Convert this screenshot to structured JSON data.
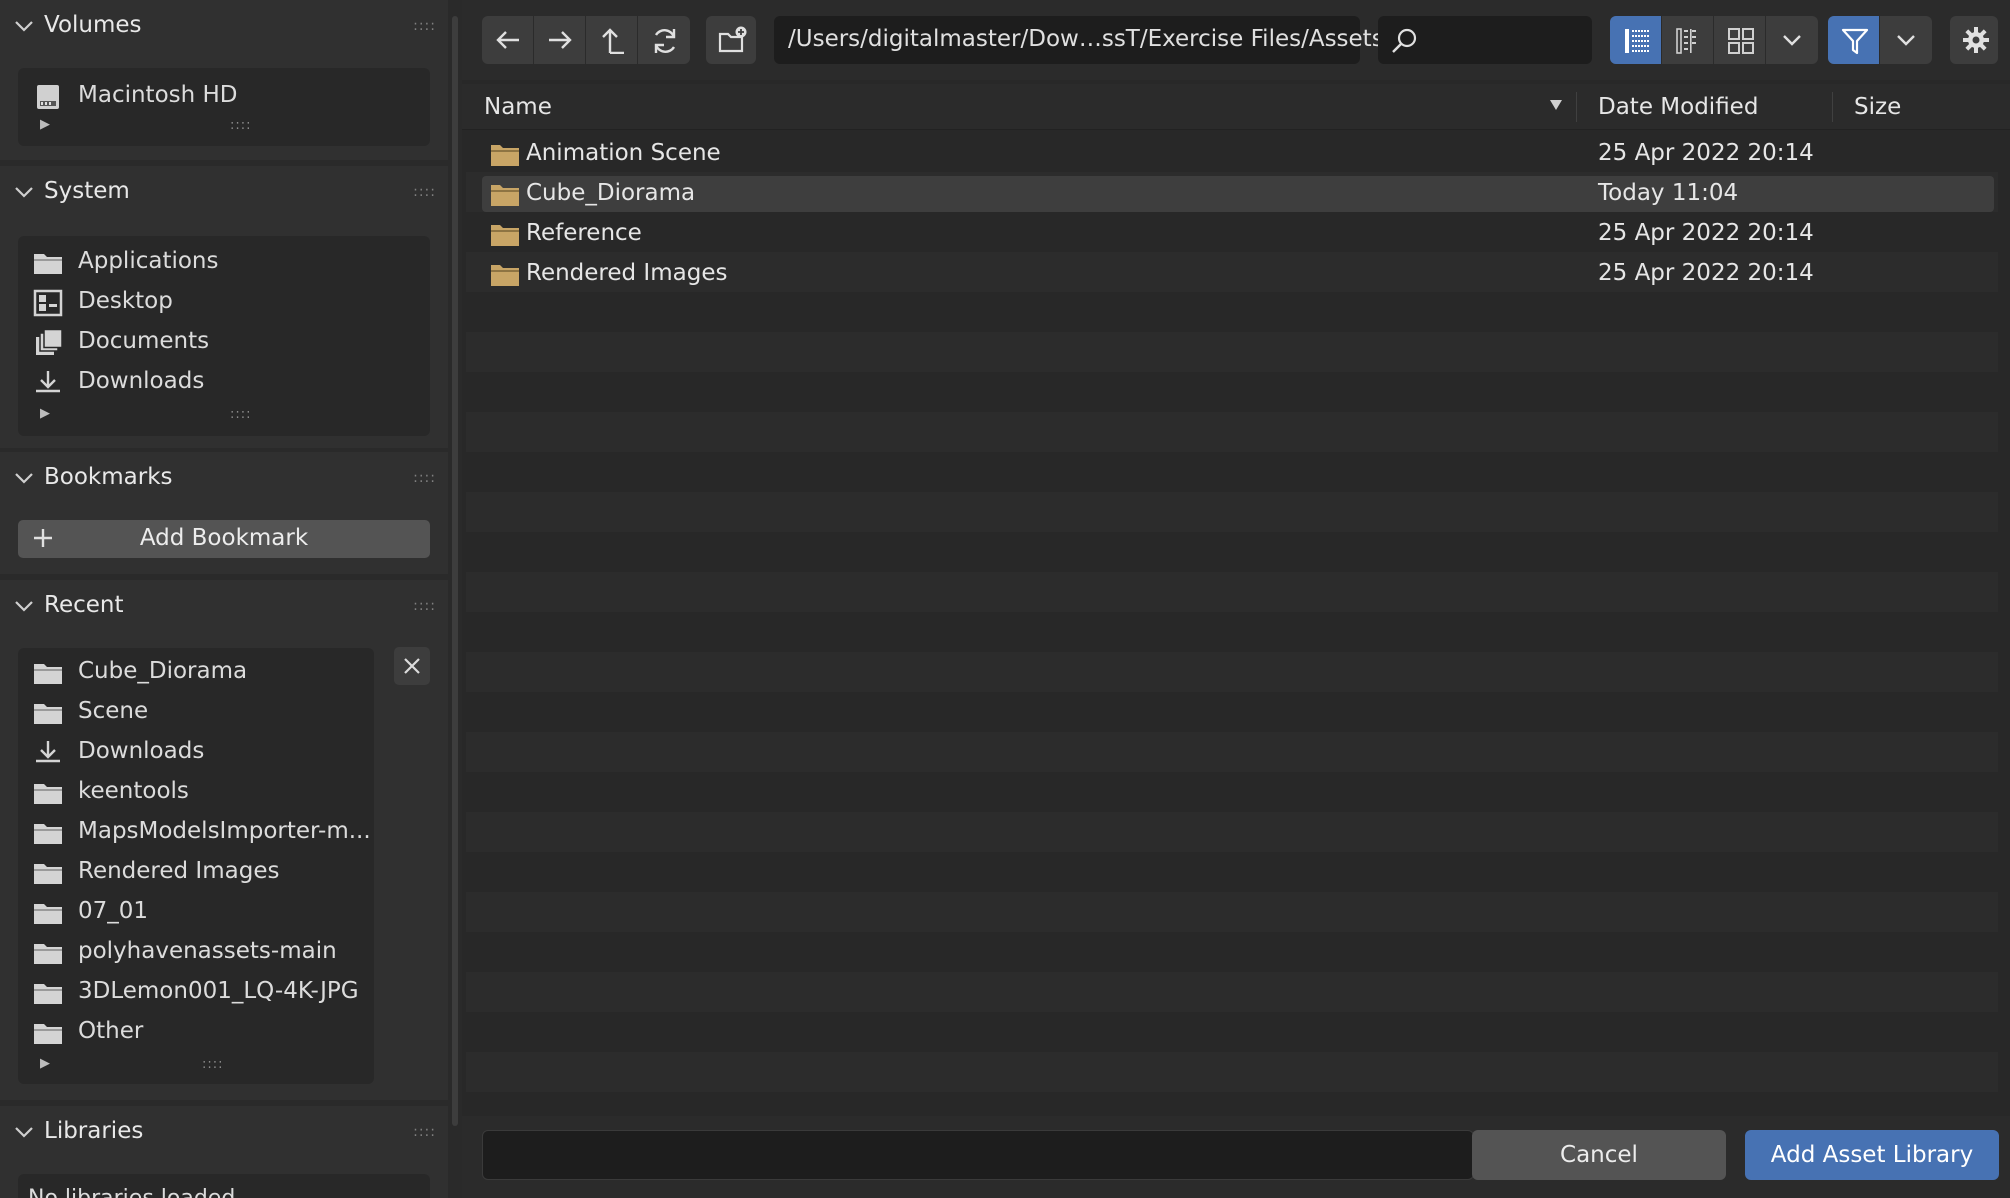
{
  "sidebar": {
    "volumes": {
      "title": "Volumes",
      "items": [
        {
          "label": "Macintosh HD",
          "icon": "disk-icon"
        }
      ]
    },
    "system": {
      "title": "System",
      "items": [
        {
          "label": "Applications",
          "icon": "folder-icon"
        },
        {
          "label": "Desktop",
          "icon": "desktop-icon"
        },
        {
          "label": "Documents",
          "icon": "documents-icon"
        },
        {
          "label": "Downloads",
          "icon": "download-icon"
        }
      ]
    },
    "bookmarks": {
      "title": "Bookmarks",
      "add_label": "Add Bookmark"
    },
    "recent": {
      "title": "Recent",
      "items": [
        {
          "label": "Cube_Diorama",
          "icon": "folder-icon"
        },
        {
          "label": "Scene",
          "icon": "folder-icon"
        },
        {
          "label": "Downloads",
          "icon": "download-icon"
        },
        {
          "label": "keentools",
          "icon": "folder-icon"
        },
        {
          "label": "MapsModelsImporter-m...",
          "icon": "folder-icon"
        },
        {
          "label": "Rendered Images",
          "icon": "folder-icon"
        },
        {
          "label": "07_01",
          "icon": "folder-icon"
        },
        {
          "label": "polyhavenassets-main",
          "icon": "folder-icon"
        },
        {
          "label": "3DLemon001_LQ-4K-JPG",
          "icon": "folder-icon"
        },
        {
          "label": "Other",
          "icon": "folder-icon"
        }
      ]
    },
    "libraries": {
      "title": "Libraries",
      "empty_text": "No libraries loaded"
    }
  },
  "toolbar": {
    "path": "/Users/digitalmaster/Dow…ssT/Exercise Files/Assets/",
    "search_placeholder": ""
  },
  "columns": {
    "name": "Name",
    "date": "Date Modified",
    "size": "Size"
  },
  "files": [
    {
      "name": "Animation Scene",
      "date": "25 Apr 2022 20:14",
      "selected": false
    },
    {
      "name": "Cube_Diorama",
      "date": "Today 11:04",
      "selected": true
    },
    {
      "name": "Reference",
      "date": "25 Apr 2022 20:14",
      "selected": false
    },
    {
      "name": "Rendered Images",
      "date": "25 Apr 2022 20:14",
      "selected": false
    }
  ],
  "footer": {
    "filename": "",
    "cancel_label": "Cancel",
    "confirm_label": "Add Asset Library"
  },
  "colors": {
    "accent": "#4772b3",
    "folder": "#c8a566",
    "background": "#282828"
  }
}
